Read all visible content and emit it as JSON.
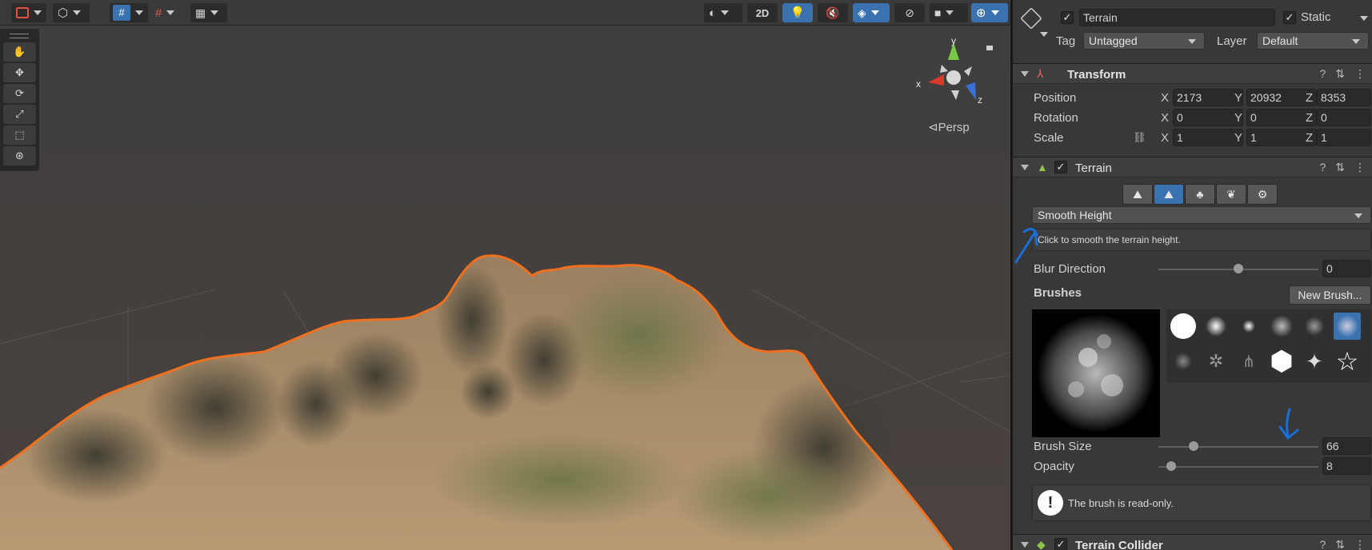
{
  "scene": {
    "toolbar": {
      "view_2d_label": "2D"
    },
    "view_mode_label": "⊲Persp",
    "gizmo": {
      "x_label": "x",
      "y_label": "y",
      "z_label": "z"
    },
    "tools": [
      "hand-tool",
      "move-tool",
      "rotate-tool",
      "scale-tool",
      "rect-tool",
      "transform-tool"
    ]
  },
  "inspector": {
    "object_name": "Terrain",
    "static_label": "Static",
    "tag_label": "Tag",
    "tag_value": "Untagged",
    "layer_label": "Layer",
    "layer_value": "Default",
    "transform": {
      "title": "Transform",
      "position_label": "Position",
      "rotation_label": "Rotation",
      "scale_label": "Scale",
      "position": {
        "x": "2173",
        "y": "20932",
        "z": "8353"
      },
      "rotation": {
        "x": "0",
        "y": "0",
        "z": "0"
      },
      "scale": {
        "x": "1",
        "y": "1",
        "z": "1"
      },
      "axis": {
        "x": "X",
        "y": "Y",
        "z": "Z"
      }
    },
    "terrain": {
      "title": "Terrain",
      "tool_dropdown": "Smooth Height",
      "tool_hint": "Click to smooth the terrain height.",
      "blur_label": "Blur Direction",
      "blur_value": "0",
      "blur_fraction": 0.5,
      "brushes_label": "Brushes",
      "new_brush_label": "New Brush...",
      "brush_size_label": "Brush Size",
      "brush_size_value": "66",
      "brush_size_fraction": 0.22,
      "opacity_label": "Opacity",
      "opacity_value": "8",
      "opacity_fraction": 0.08,
      "readonly_message": "The brush is read-only."
    },
    "collider": {
      "title": "Terrain Collider"
    }
  },
  "colors": {
    "accent": "#3a72b0",
    "selection_outline": "#f07020",
    "annotation": "#1a6fd6"
  }
}
